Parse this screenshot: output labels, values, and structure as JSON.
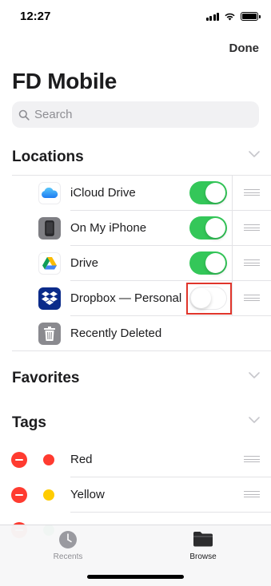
{
  "status_bar": {
    "time": "12:27"
  },
  "header": {
    "done_label": "Done",
    "title": "FD Mobile"
  },
  "search": {
    "placeholder": "Search"
  },
  "sections": {
    "locations": {
      "title": "Locations"
    },
    "favorites": {
      "title": "Favorites"
    },
    "tags": {
      "title": "Tags"
    }
  },
  "locations": [
    {
      "label": "iCloud Drive",
      "icon": "icloud-icon",
      "enabled": true
    },
    {
      "label": "On My iPhone",
      "icon": "iphone-icon",
      "enabled": true
    },
    {
      "label": "Drive",
      "icon": "google-drive-icon",
      "enabled": true
    },
    {
      "label": "Dropbox — Personal",
      "icon": "dropbox-icon",
      "enabled": false,
      "highlighted": true
    },
    {
      "label": "Recently Deleted",
      "icon": "trash-icon"
    }
  ],
  "tags": [
    {
      "label": "Red",
      "color": "#ff3b30"
    },
    {
      "label": "Yellow",
      "color": "#ffcc00"
    }
  ],
  "tab_bar": {
    "recents_label": "Recents",
    "browse_label": "Browse",
    "selected": "Browse"
  },
  "colors": {
    "toggle_on": "#34c759",
    "highlight_border": "#e0352b",
    "delete_red": "#ff3b30",
    "tag_green": "#34c759"
  }
}
